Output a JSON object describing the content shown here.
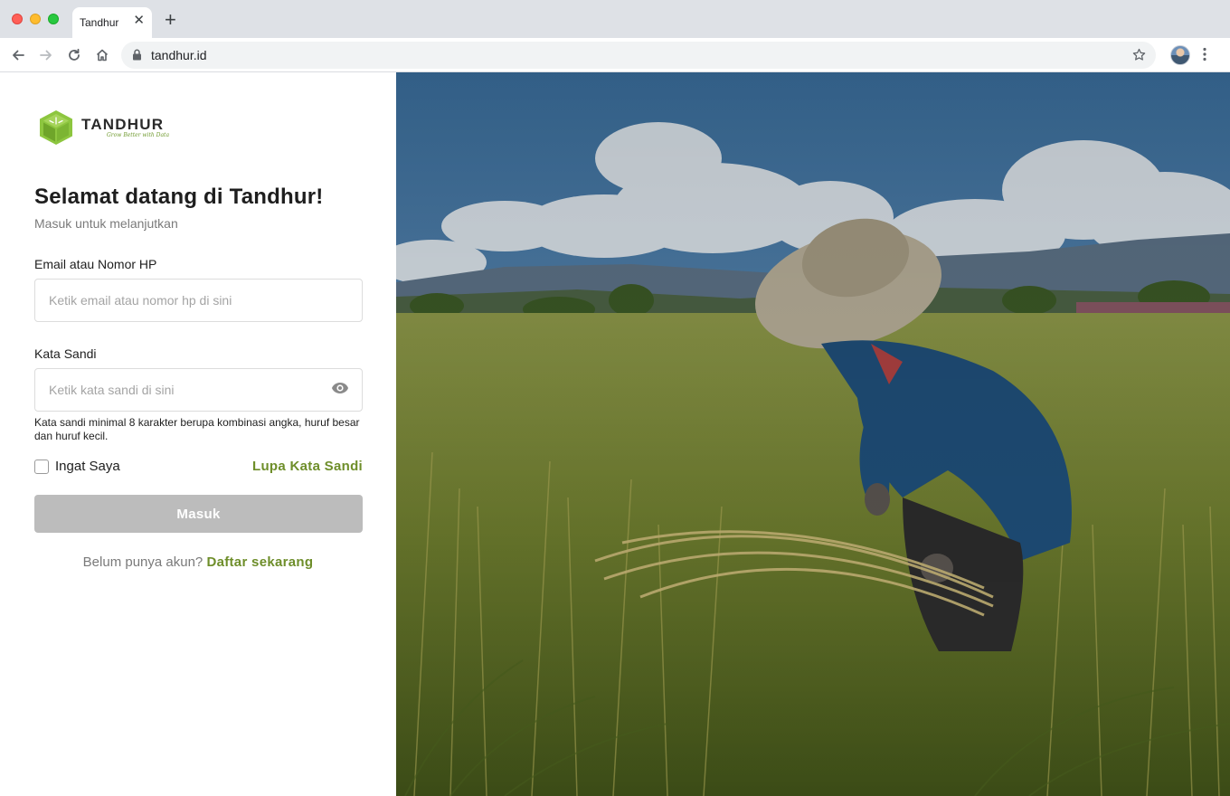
{
  "browser": {
    "tab_title": "Tandhur",
    "tab_close": "✕",
    "new_tab": "+",
    "url": "tandhur.id"
  },
  "brand": {
    "name": "TANDHUR",
    "tagline": "Grow Better with Data"
  },
  "login": {
    "title": "Selamat datang di Tandhur!",
    "subtitle": "Masuk untuk melanjutkan",
    "email_label": "Email atau Nomor HP",
    "email_placeholder": "Ketik email atau nomor hp di sini",
    "password_label": "Kata Sandi",
    "password_placeholder": "Ketik kata sandi di sini",
    "password_hint": "Kata sandi minimal 8 karakter berupa kombinasi angka, huruf besar dan huruf kecil.",
    "remember_label": "Ingat Saya",
    "forgot_label": "Lupa Kata Sandi",
    "submit_label": "Masuk",
    "no_account_text": "Belum punya akun?",
    "signup_label": "Daftar sekarang"
  },
  "colors": {
    "accent": "#6e8e2a",
    "logo_green": "#8dc63f",
    "button_disabled": "#bcbcbc"
  }
}
